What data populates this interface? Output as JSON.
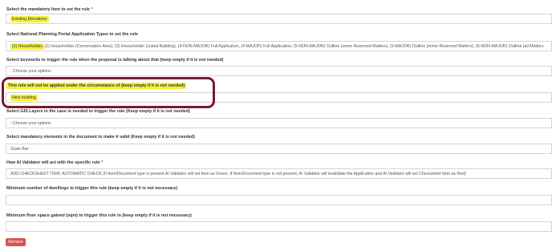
{
  "fields": {
    "mandatory_item": {
      "label": "Select the mandatory Item to set the rule",
      "required": "*",
      "value": "Existing Elevations"
    },
    "application_types": {
      "label": "Select National Planning Portal Application Types to set the rule",
      "value_highlight": "(1) Householder,",
      "value_rest": " (2) Householder (Conservation Area), (3) Householder (Listed Building), (4-NON-MAJOR) Full Application, (4-MAJOR) Full Application, (5-NON-MAJOR) Outline (some Reserved Matters), (5-MAJOR) Outline (some Reserved Matters), (6-NON-MAJOR) Outline (all Matters"
    },
    "keywords": {
      "label": "Select keywords to trigger the rule when the proposal is talking about that (keep empty if it is not needed)",
      "placeholder": "- Choose your options"
    },
    "exclusion": {
      "label": "This rule will not be applied under the circumstance of (keep empty if it is not needed)",
      "value": "New building"
    },
    "layers": {
      "label": "Select GIS Layers in the case is needed to trigger the rule (Keep empty if it is not needed)",
      "placeholder": "- Choose your options"
    },
    "mandatory_elements": {
      "label": "Select mandatory elements in the document to make it valid (Keep empty if it is not needed)",
      "value": "Scale Bar"
    },
    "ai_validator": {
      "label": "How AI Validator will act with the specific rule",
      "required": "*",
      "value": "ADD CHECKSHEET ITEM, AUTOMATIC CHECK (If Item/Document type is present AI Validator will set Item as Green. If Item/Document type is not present, AI Validator will invalidate the Application and AI Validator will set Checksheet Item as Red)"
    },
    "min_dwellings": {
      "label": "Minimum number of dwellings to trigger this rule (keep empty if it is not necessary)",
      "value": ""
    },
    "min_floor_space": {
      "label": "Minimum floor space gained (sqm) to trigger this rule in (keep empty if it is not necessary)",
      "value": ""
    }
  },
  "buttons": {
    "remove_label": "Remove"
  },
  "colors": {
    "highlight": "#f5f23c",
    "annotation": "#7a1a2e",
    "remove_button": "#d9534f"
  }
}
